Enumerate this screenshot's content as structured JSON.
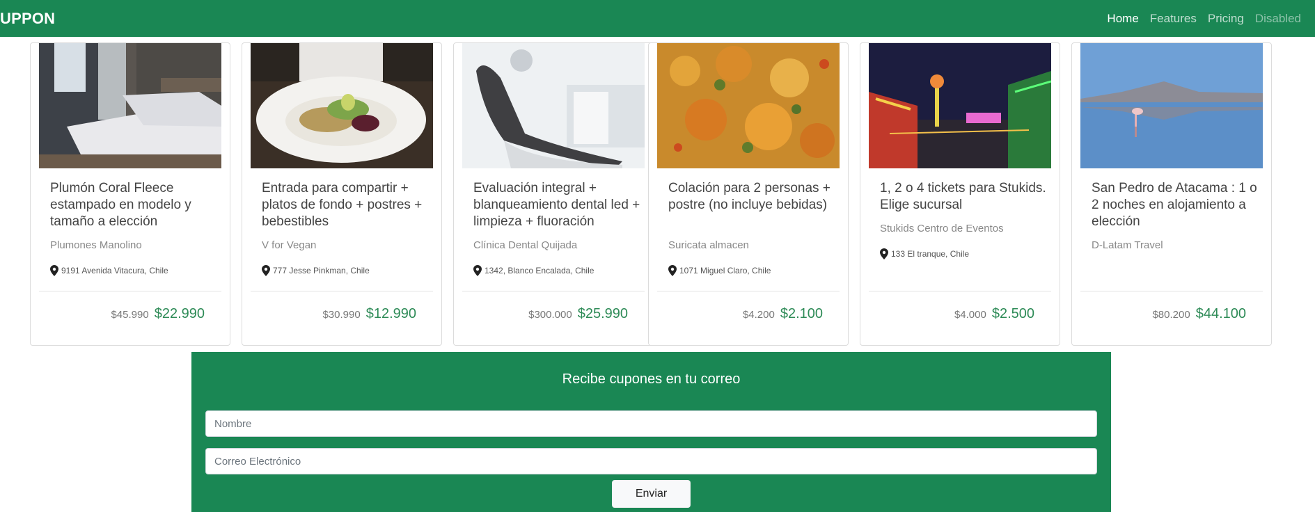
{
  "navbar": {
    "brand": "UPPON",
    "links": [
      "Home",
      "Features",
      "Pricing",
      "Disabled"
    ]
  },
  "cards": [
    {
      "title": "Plumón Coral Fleece estampado en modelo y tamaño a elección",
      "merchant": "Plumones Manolino",
      "location": "9191 Avenida Vitacura, Chile",
      "old_price": "$45.990",
      "new_price": "$22.990",
      "image": "bedroom"
    },
    {
      "title": "Entrada para compartir + platos de fondo + postres + bebestibles",
      "merchant": "V for Vegan",
      "location": "777 Jesse Pinkman, Chile",
      "old_price": "$30.990",
      "new_price": "$12.990",
      "image": "salad"
    },
    {
      "title": "Evaluación integral + blanqueamiento dental led + limpieza + fluoración",
      "merchant": "Clínica Dental Quijada",
      "location": "1342, Blanco Encalada, Chile",
      "old_price": "$300.000",
      "new_price": "$25.990",
      "image": "dental-chair"
    },
    {
      "title": "Colación para 2 personas + postre (no incluye bebidas)",
      "merchant": "Suricata almacen",
      "location": "1071 Miguel Claro, Chile",
      "old_price": "$4.200",
      "new_price": "$2.100",
      "image": "food-plate"
    },
    {
      "title": "1, 2 o 4 tickets para Stukids. Elige sucursal",
      "merchant": "Stukids Centro de Eventos",
      "location": "133 El tranque, Chile",
      "old_price": "$4.000",
      "new_price": "$2.500",
      "image": "fairground"
    },
    {
      "title": "San Pedro de Atacama : 1 o 2 noches en alojamiento a elección",
      "merchant": "D-Latam Travel",
      "location": "",
      "old_price": "$80.200",
      "new_price": "$44.100",
      "image": "flamingo-lake"
    }
  ],
  "newsletter": {
    "title": "Recibe cupones en tu correo",
    "name_placeholder": "Nombre",
    "email_placeholder": "Correo Electrónico",
    "button_label": "Enviar"
  },
  "colors": {
    "brand_green": "#1a8754",
    "price_green": "#2e8b57"
  }
}
